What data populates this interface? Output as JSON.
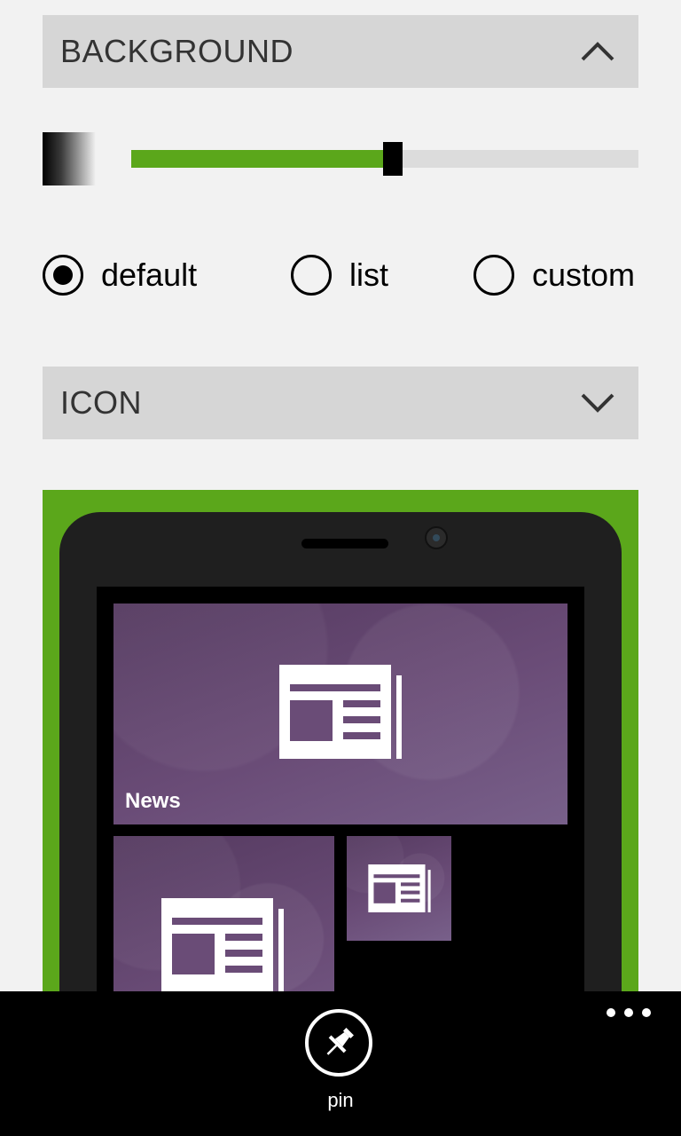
{
  "background_section": {
    "title": "BACKGROUND",
    "expanded": true,
    "slider_value_percent": 50
  },
  "layout_options": {
    "selected": "default",
    "options": [
      {
        "id": "default",
        "label": "default"
      },
      {
        "id": "list",
        "label": "list"
      },
      {
        "id": "custom",
        "label": "custom"
      }
    ]
  },
  "icon_section": {
    "title": "ICON",
    "expanded": false
  },
  "preview": {
    "background_color": "#5ba71b",
    "tile_color": "#5f4570",
    "tiles": [
      {
        "size": "wide",
        "label": "News",
        "icon": "newspaper-icon"
      },
      {
        "size": "medium",
        "label": "",
        "icon": "newspaper-icon"
      },
      {
        "size": "small",
        "label": "",
        "icon": "newspaper-icon"
      }
    ]
  },
  "appbar": {
    "buttons": [
      {
        "label": "pin",
        "icon": "pin-icon"
      }
    ],
    "more_icon": "ellipsis-icon"
  },
  "colors": {
    "accent": "#5ba71b",
    "header_bg": "#d6d6d6",
    "page_bg": "#f2f2f2"
  }
}
